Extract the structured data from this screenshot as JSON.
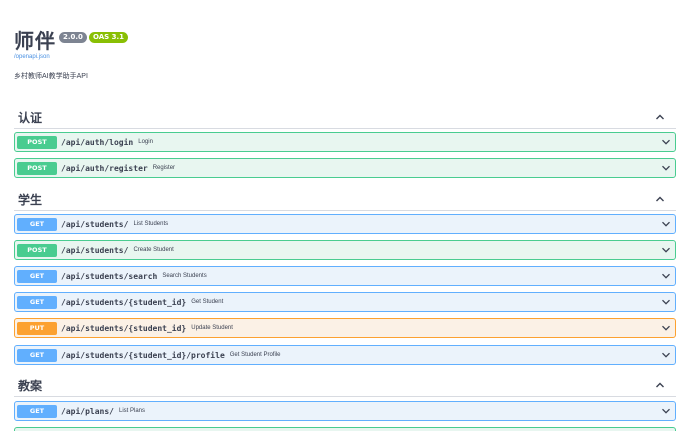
{
  "info": {
    "title": "师伴",
    "version": "2.0.0",
    "oas": "OAS 3.1",
    "spec_link": "/openapi.json",
    "description": "乡村教师AI教学助手API"
  },
  "colors": {
    "get": "#61affe",
    "post": "#49cc90",
    "put": "#fca130",
    "text": "#3b4151",
    "link": "#4990e2"
  },
  "icons": {
    "tag_toggle": "chevron-up-icon",
    "op_toggle": "chevron-down-icon"
  },
  "tags": [
    {
      "name": "认证",
      "operations": [
        {
          "method": "POST",
          "path": "/api/auth/login",
          "summary": "Login"
        },
        {
          "method": "POST",
          "path": "/api/auth/register",
          "summary": "Register"
        }
      ]
    },
    {
      "name": "学生",
      "operations": [
        {
          "method": "GET",
          "path": "/api/students/",
          "summary": "List Students"
        },
        {
          "method": "POST",
          "path": "/api/students/",
          "summary": "Create Student"
        },
        {
          "method": "GET",
          "path": "/api/students/search",
          "summary": "Search Students"
        },
        {
          "method": "GET",
          "path": "/api/students/{student_id}",
          "summary": "Get Student"
        },
        {
          "method": "PUT",
          "path": "/api/students/{student_id}",
          "summary": "Update Student"
        },
        {
          "method": "GET",
          "path": "/api/students/{student_id}/profile",
          "summary": "Get Student Profile"
        }
      ]
    },
    {
      "name": "教案",
      "operations": [
        {
          "method": "GET",
          "path": "/api/plans/",
          "summary": "List Plans"
        }
      ]
    }
  ]
}
